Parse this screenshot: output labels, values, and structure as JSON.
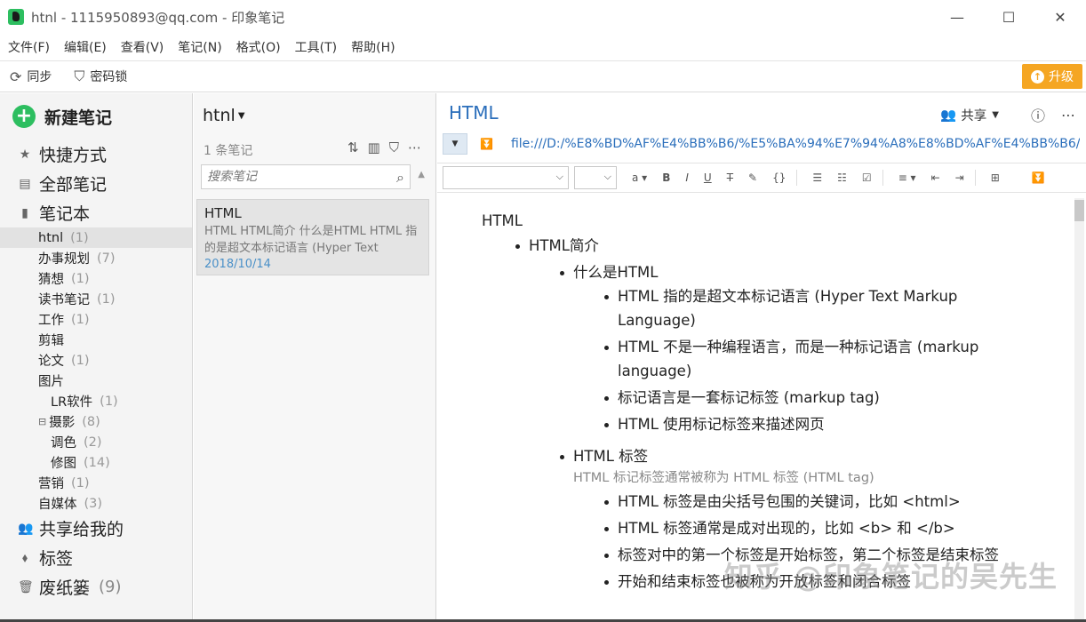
{
  "window": {
    "title": "htnl - 1115950893@qq.com - 印象笔记",
    "minimize": "—",
    "maximize": "☐",
    "close": "✕"
  },
  "menu": [
    "文件(F)",
    "编辑(E)",
    "查看(V)",
    "笔记(N)",
    "格式(O)",
    "工具(T)",
    "帮助(H)"
  ],
  "toolbar": {
    "sync": "同步",
    "lock": "密码锁",
    "upgrade": "升级"
  },
  "sidebar": {
    "new_note": "新建笔记",
    "shortcuts": "快捷方式",
    "all_notes": "全部笔记",
    "notebooks": "笔记本",
    "notebook_items": [
      {
        "name": "htnl",
        "count": "(1)"
      },
      {
        "name": "办事规划",
        "count": "(7)"
      },
      {
        "name": "猜想",
        "count": "(1)"
      },
      {
        "name": "读书笔记",
        "count": "(1)"
      },
      {
        "name": "工作",
        "count": "(1)"
      },
      {
        "name": "剪辑",
        "count": ""
      },
      {
        "name": "论文",
        "count": "(1)"
      },
      {
        "name": "图片",
        "count": ""
      },
      {
        "name": "LR软件",
        "count": "(1)"
      },
      {
        "name": "摄影",
        "count": "(8)"
      },
      {
        "name": "调色",
        "count": "(2)"
      },
      {
        "name": "修图",
        "count": "(14)"
      },
      {
        "name": "营销",
        "count": "(1)"
      },
      {
        "name": "自媒体",
        "count": "(3)"
      }
    ],
    "shared": "共享给我的",
    "tags": "标签",
    "trash": "废纸篓",
    "trash_count": "(9)"
  },
  "notelist": {
    "title": "htnl",
    "count": "1 条笔记",
    "search_placeholder": "搜索笔记",
    "note": {
      "title": "HTML",
      "snippet": "HTML HTML简介 什么是HTML HTML 指的是超文本标记语言 (Hyper Text Mark...",
      "date": "2018/10/14"
    }
  },
  "editor": {
    "title": "HTML",
    "share": "共享",
    "url": "file:///D:/%E8%BD%AF%E4%BB%B6/%E5%BA%94%E7%94%A8%E8%BD%AF%E4%BB%B6/%",
    "content": {
      "root": "HTML",
      "s1": "HTML简介",
      "s1_1": "什么是HTML",
      "s1_1_items": [
        "HTML 指的是超文本标记语言 (Hyper Text Markup Language)",
        "HTML 不是一种编程语言，而是一种标记语言 (markup language)",
        "标记语言是一套标记标签 (markup tag)",
        "HTML 使用标记标签来描述网页"
      ],
      "s1_2": "HTML 标签",
      "s1_2_sub": "HTML 标记标签通常被称为 HTML 标签 (HTML tag)",
      "s1_2_items": [
        "HTML 标签是由尖括号包围的关键词，比如 <html>",
        "HTML 标签通常是成对出现的，比如 <b> 和 </b>",
        "标签对中的第一个标签是开始标签，第二个标签是结束标签",
        "开始和结束标签也被称为开放标签和闭合标签"
      ]
    },
    "watermark": "知乎 @印象笔记的吴先生"
  }
}
